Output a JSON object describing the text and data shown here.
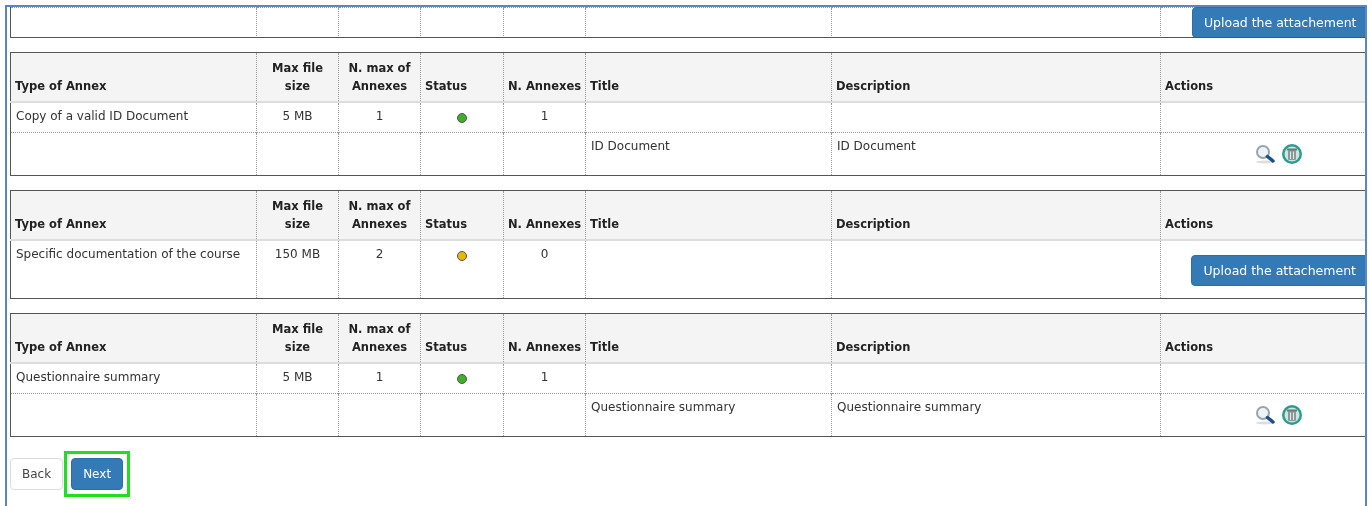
{
  "previous_section": {
    "upload_button": "Upload the attachement"
  },
  "annexes": [
    {
      "columns": [
        "Type of Annex",
        "Max file size",
        "N. max of Annexes",
        "Status",
        "N. Annexes",
        "Title",
        "Description",
        "Actions"
      ],
      "type": "Copy of a valid ID Document",
      "max_file_size": "5 MB",
      "max_annexes": "1",
      "color": "#3fae2a",
      "n_annexes": "1",
      "files": [
        {
          "title": "ID Document",
          "description": "ID Document"
        }
      ]
    },
    {
      "columns": [
        "Type of Annex",
        "Max file size",
        "N. max of Annexes",
        "Status",
        "N. Annexes",
        "Title",
        "Description",
        "Actions"
      ],
      "type": "Specific documentation of the course",
      "max_file_size": "150 MB",
      "max_annexes": "2",
      "color": "#e6b800",
      "n_annexes": "0",
      "upload_button": "Upload the attachement"
    },
    {
      "columns": [
        "Type of Annex",
        "Max file size",
        "N. max of Annexes",
        "Status",
        "N. Annexes",
        "Title",
        "Description",
        "Actions"
      ],
      "type": "Questionnaire summary",
      "max_file_size": "5 MB",
      "max_annexes": "1",
      "color": "#3fae2a",
      "n_annexes": "1",
      "files": [
        {
          "title": "Questionnaire summary",
          "description": "Questionnaire summary"
        }
      ]
    }
  ],
  "buttons": [
    {
      "label": "Back",
      "kind": "default",
      "highlighted": false
    },
    {
      "label": "Next",
      "kind": "primary",
      "highlighted": true
    }
  ]
}
